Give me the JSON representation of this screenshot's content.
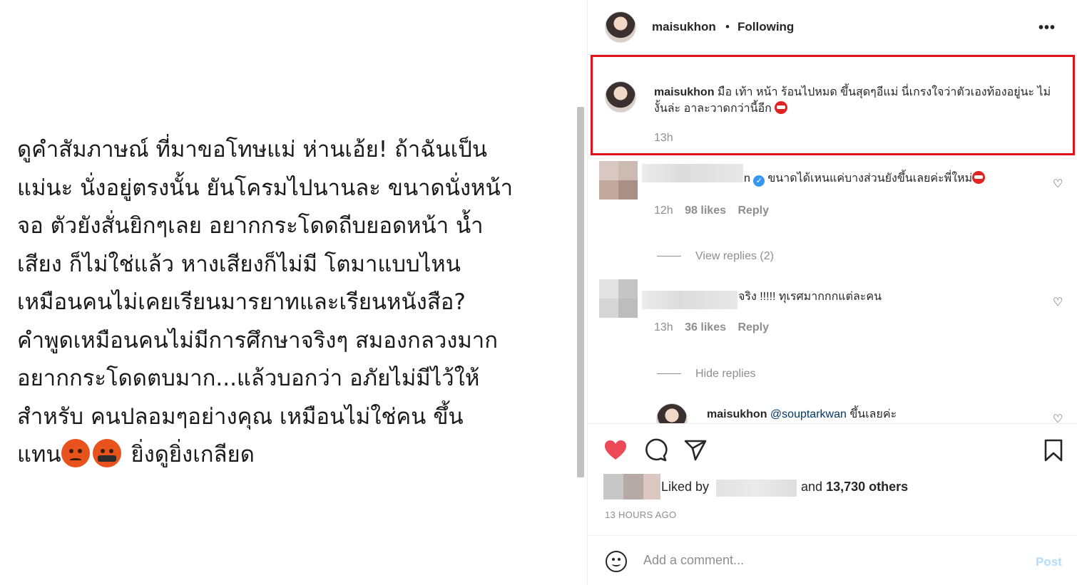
{
  "post_image": {
    "lines": [
      "ดูคำสัมภาษณ์ ที่มาขอโทษแม่ ห่านเอ้ย! ถ้าฉันเป็น",
      "แม่นะ นั่งอยู่ตรงนั้น ยันโครมไปนานละ ขนาดนั่งหน้า",
      "จอ ตัวยังสั่นยิกๆเลย อยากกระโดดถีบยอดหน้า น้ำ",
      "เสียง ก็ไม่ใช่แล้ว หางเสียงก็ไม่มี โตมาแบบไหน",
      "เหมือนคนไม่เคยเรียนมารยาทและเรียนหนังสือ?",
      "คำพูดเหมือนคนไม่มีการศึกษาจริงๆ สมองกลวงมาก",
      "อยากกระโดดตบมาก...แล้วบอกว่า อภัยไม่มีไว้ให้",
      "สำหรับ คนปลอมๆอย่างคุณ เหมือนไม่ใช่คน ขึ้น"
    ],
    "last_line_prefix": "แทน",
    "last_line_suffix": " ยิ่งดูยิ่งเกลียด",
    "emojis": [
      "angry-face-emoji",
      "cursing-face-emoji"
    ]
  },
  "header": {
    "username": "maisukhon",
    "separator": "•",
    "follow_status": "Following",
    "more_icon": "•••"
  },
  "caption": {
    "username": "maisukhon",
    "text": " มือ เท้า หน้า ร้อนไปหมด ขึ้นสุดๆอีแม่ นี่เกรงใจว่าตัวเองท้องอยู่นะ ไม่งั้นล่ะ อาละวาดกว่านี้อีก",
    "time": "13h"
  },
  "comments": [
    {
      "name_suffix": "n",
      "text": "ขนาดได้เหนแค่บางส่วนยังขึ้นเลยค่ะพี่ใหม่",
      "time": "12h",
      "likes": "98 likes",
      "reply": "Reply",
      "replies_toggle": "View replies (2)"
    },
    {
      "text": "จริง !!!!! ทุเรศมากกกแต่ละคน",
      "time": "13h",
      "likes": "36 likes",
      "reply": "Reply",
      "replies_toggle": "Hide replies"
    }
  ],
  "reply": {
    "username": "maisukhon",
    "mention": "@souptarkwan",
    "text": " ขึ้นเลยค่ะ"
  },
  "likes": {
    "prefix": "Liked by",
    "and": "and",
    "others": "13,730 others"
  },
  "timestamp": "13 HOURS AGO",
  "add_comment": {
    "placeholder": "Add a comment...",
    "post": "Post"
  },
  "colors": {
    "like_red": "#ed4956",
    "highlight": "#e0121a",
    "verified": "#3897f0",
    "post_disabled": "#b3dbff"
  }
}
